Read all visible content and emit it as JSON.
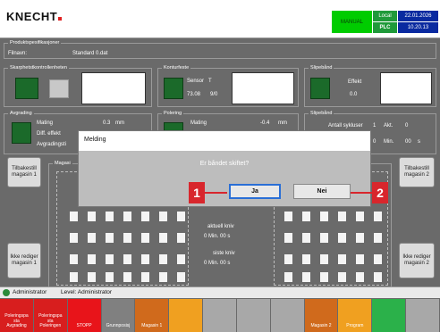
{
  "header": {
    "logo": "KNECHT",
    "mode": "MANUAL",
    "local_label": "Local",
    "plc_label": "PLC",
    "date": "22.01.2026",
    "time": "10.20.13"
  },
  "product_spec": {
    "title": "Produktspesifikasjoner",
    "filename_label": "Filnavn:",
    "filename_value": "Standard 0.dat"
  },
  "groups": {
    "sharpness": "Skarphetstkontrollenheten",
    "contour": "Konturfeste",
    "belt1": "Slipebånd",
    "deburr": "Avgrading",
    "polish": "Polering",
    "belt2": "Slipebånd",
    "magazine": "Magasi"
  },
  "contour": {
    "sensor_label": "Sensor",
    "sensor_unit": "T",
    "value1": "73.08",
    "value2": "9/0"
  },
  "belt1": {
    "effect_label": "Effekt",
    "effect_value": "0.0"
  },
  "deburr": {
    "feed_label": "Mating",
    "feed_value": "0.3",
    "feed_unit": "mm",
    "diff_label": "Diff. effekt",
    "deburr_label": "Avgradingsti"
  },
  "polish": {
    "feed_label": "Mating",
    "feed_value": "-0.4",
    "feed_unit": "mm"
  },
  "belt2": {
    "cycles_label": "Antall sykluser",
    "cycles_value": "1",
    "act_label": "Akt.",
    "act_value": "0",
    "min_value": "0",
    "min_label": "Min.",
    "sec_value": "00",
    "sec_unit": "s"
  },
  "side_buttons": {
    "left_top": "Tilbakestill magasin 1",
    "left_bottom": "Ikke rediger magasin 1",
    "right_top": "Tilbakestill magasin 2",
    "right_bottom": "Ikke rediger magasin 2"
  },
  "center_info": {
    "current_knife": "aktuell kniv",
    "current_time": "0   Min.   00   s",
    "last_knife": "siste kniv",
    "last_time": "0   Min.   00   s"
  },
  "dialog": {
    "title": "Melding",
    "message": "Er båndet skiftet?",
    "yes_label": "Ja",
    "no_label": "Nei",
    "callout_1": "1",
    "callout_2": "2"
  },
  "status_bar": {
    "user_label": "Administrator",
    "level_label": "Level: Administrator"
  },
  "taskbar": [
    {
      "label": "Poleringspa\nsta\nAvgrading",
      "color": "#d81e1e"
    },
    {
      "label": "Poleringspa\nsta\nPoleringen",
      "color": "#d81e1e"
    },
    {
      "label": "STOPP",
      "color": "#e8141a"
    },
    {
      "label": "Grunnposisj",
      "color": "#808080"
    },
    {
      "label": "Magasin 1",
      "color": "#d06a1c"
    },
    {
      "label": "",
      "color": "#f0a020"
    },
    {
      "label": "",
      "color": "#a8a8a8"
    },
    {
      "label": "",
      "color": "#a8a8a8"
    },
    {
      "label": "",
      "color": "#a8a8a8"
    },
    {
      "label": "Magasin 2",
      "color": "#d06a1c"
    },
    {
      "label": "Program",
      "color": "#f0a020"
    },
    {
      "label": "",
      "color": "#2bb14a"
    },
    {
      "label": "",
      "color": "#a8a8a8"
    }
  ],
  "colors": {
    "background": "#6a6a6a",
    "header": "#ffffff",
    "manual_bg": "#00d000",
    "plc_bg": "#1f9a3a",
    "datetime_bg": "#0a2aa0",
    "callout": "#d8262c"
  }
}
